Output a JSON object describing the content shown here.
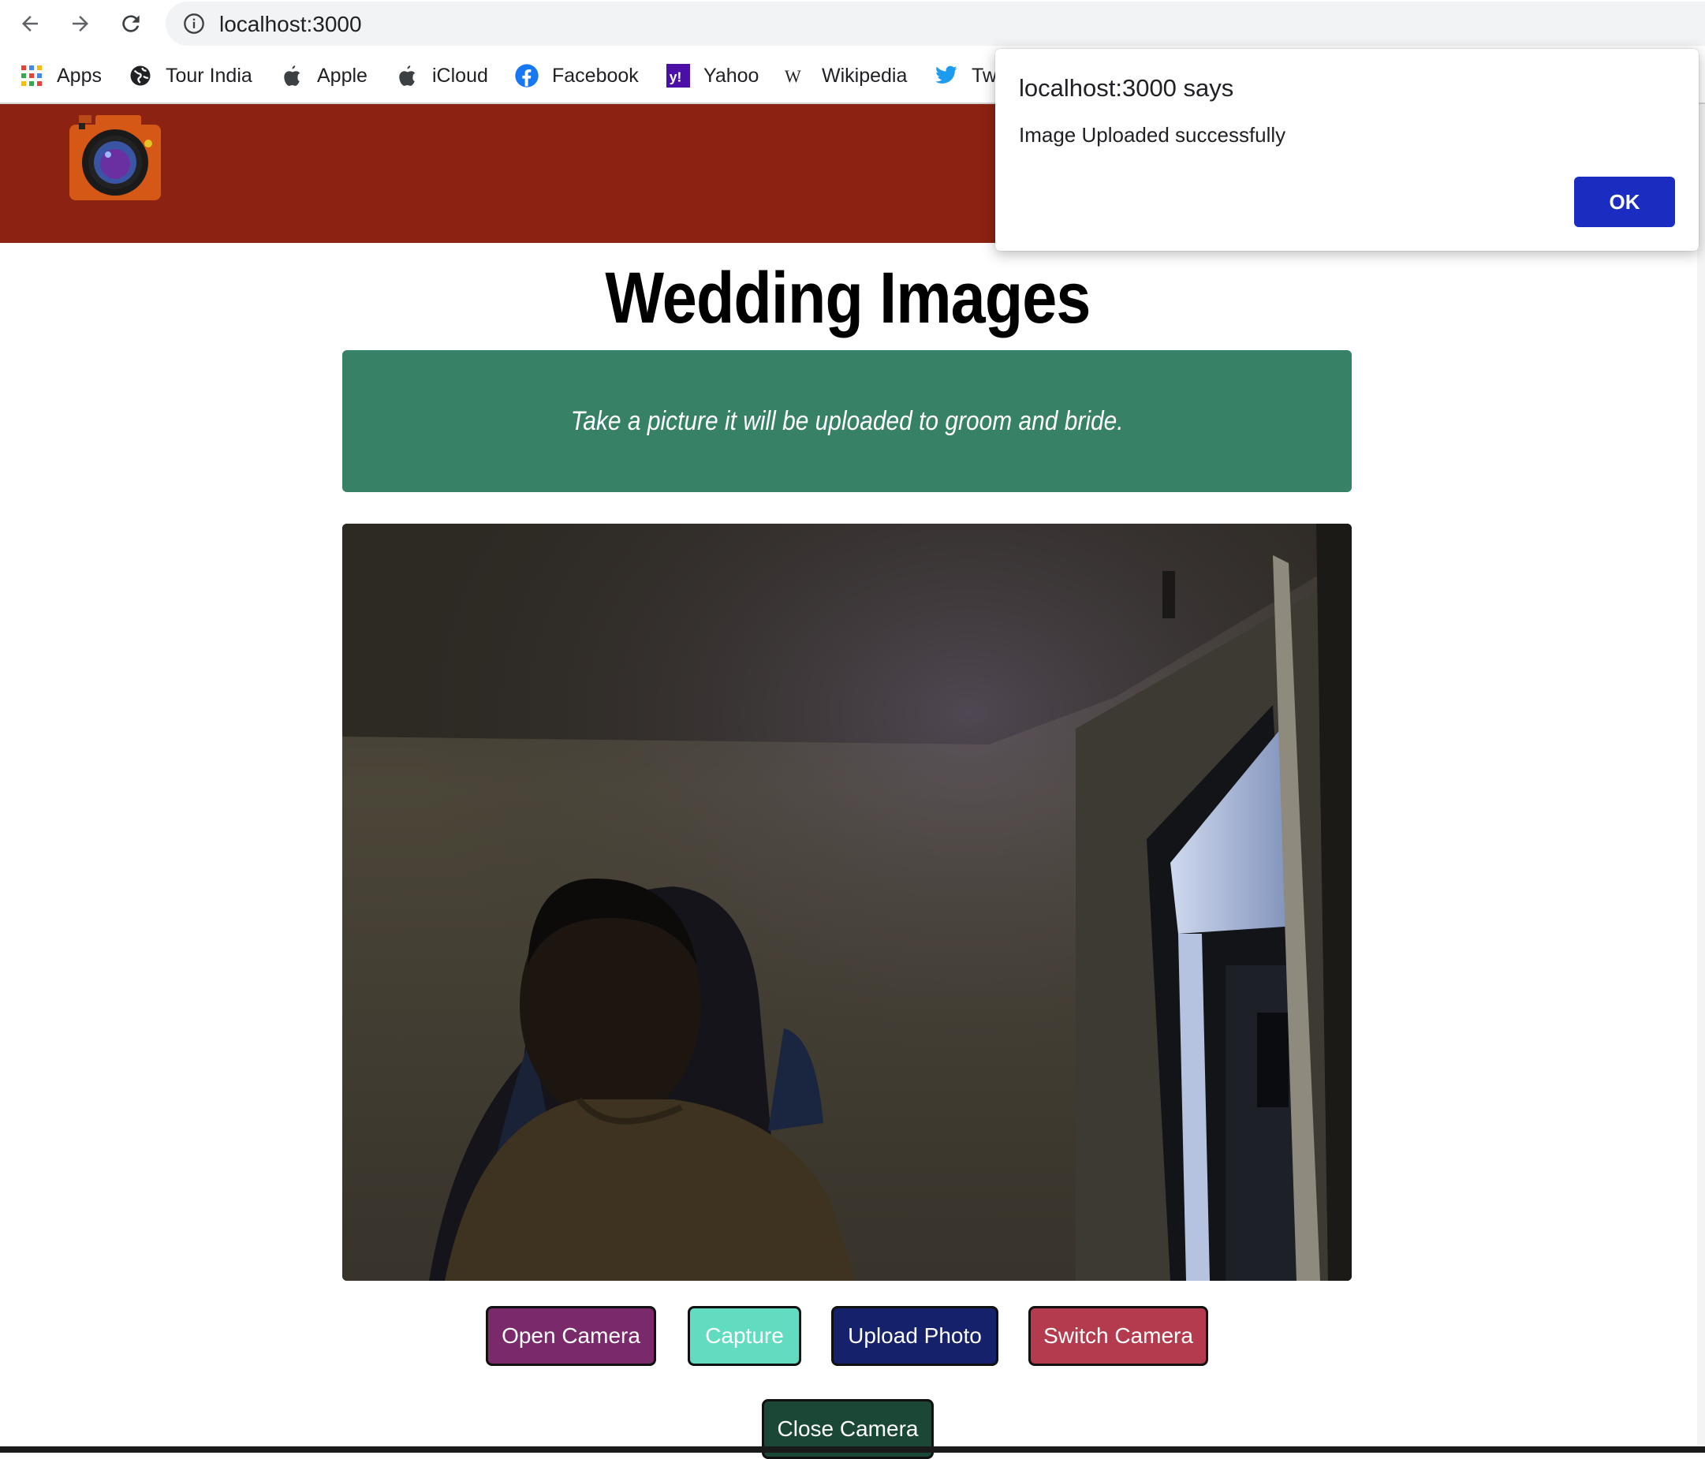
{
  "browser": {
    "url": "localhost:3000",
    "bookmarks": [
      "Apps",
      "Tour India",
      "Apple",
      "iCloud",
      "Facebook",
      "Yahoo",
      "Wikipedia",
      "Tw"
    ]
  },
  "page": {
    "title": "Wedding Images",
    "banner_text": "Take a picture it will be uploaded to groom and bride.",
    "buttons": {
      "open_camera": "Open Camera",
      "capture": "Capture",
      "upload_photo": "Upload Photo",
      "switch_camera": "Switch Camera",
      "close_camera": "Close Camera"
    }
  },
  "dialog": {
    "title": "localhost:3000 says",
    "message": "Image Uploaded successfully",
    "ok_label": "OK"
  },
  "colors": {
    "header": "#8c2211",
    "banner": "#378166",
    "open_camera": "#7a2a6b",
    "capture": "#62dcc0",
    "upload_photo": "#15216a",
    "switch_camera": "#b43b4e",
    "close_camera": "#1b4737",
    "dialog_ok": "#1a2dc0"
  },
  "icons": [
    "back-arrow-icon",
    "forward-arrow-icon",
    "reload-icon",
    "info-icon",
    "apps-grid-icon",
    "globe-icon",
    "apple-icon",
    "facebook-icon",
    "yahoo-icon",
    "wikipedia-icon",
    "twitter-icon",
    "camera-logo-icon"
  ]
}
